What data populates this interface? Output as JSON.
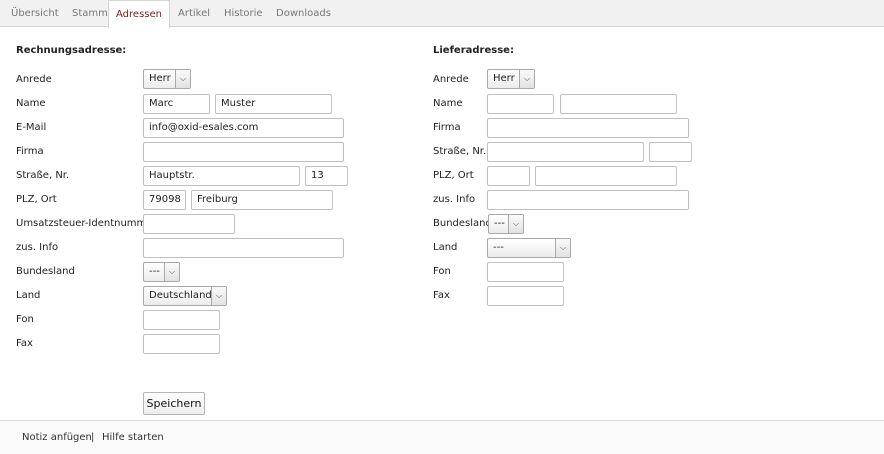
{
  "tabs": [
    {
      "label": "Übersicht"
    },
    {
      "label": "Stamm"
    },
    {
      "label": "Adressen"
    },
    {
      "label": "Artikel"
    },
    {
      "label": "Historie"
    },
    {
      "label": "Downloads"
    }
  ],
  "active_tab": "Adressen",
  "billing": {
    "title": "Rechnungsadresse:",
    "labels": {
      "salutation": "Anrede",
      "name": "Name",
      "email": "E-Mail",
      "company": "Firma",
      "street": "Straße, Nr.",
      "zip_city": "PLZ, Ort",
      "vat_id": "Umsatzsteuer-Identnummer",
      "add_info": "zus. Info",
      "state": "Bundesland",
      "country": "Land",
      "phone": "Fon",
      "fax": "Fax"
    },
    "values": {
      "salutation": "Herr",
      "first_name": "Marc",
      "last_name": "Muster",
      "email": "info@oxid-esales.com",
      "company": "",
      "street": "Hauptstr.",
      "street_nr": "13",
      "zip": "79098",
      "city": "Freiburg",
      "vat_id": "",
      "add_info": "",
      "state": "---",
      "country": "Deutschland",
      "phone": "",
      "fax": ""
    }
  },
  "delivery": {
    "title": "Lieferadresse:",
    "labels": {
      "salutation": "Anrede",
      "name": "Name",
      "company": "Firma",
      "street": "Straße, Nr.",
      "zip_city": "PLZ, Ort",
      "add_info": "zus. Info",
      "state": "Bundesland",
      "country": "Land",
      "phone": "Fon",
      "fax": "Fax"
    },
    "values": {
      "salutation": "Herr",
      "first_name": "",
      "last_name": "",
      "company": "",
      "street": "",
      "street_nr": "",
      "zip": "",
      "city": "",
      "add_info": "",
      "state": "---",
      "country": "---",
      "phone": "",
      "fax": ""
    }
  },
  "save_button": "Speichern",
  "footer": {
    "add_note": "Notiz anfügen",
    "separator": "|",
    "help": "Hilfe starten"
  },
  "icons": {
    "dropdown": "chevron-down-icon"
  }
}
